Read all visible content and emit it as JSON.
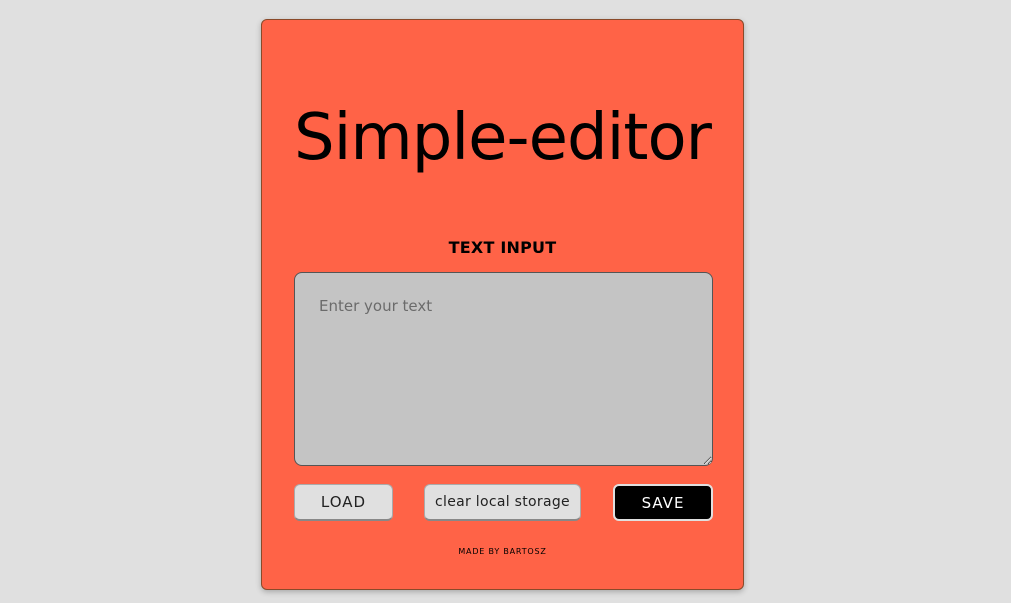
{
  "app": {
    "title": "Simple-editor"
  },
  "editor": {
    "label": "TEXT INPUT",
    "placeholder": "Enter your text",
    "value": ""
  },
  "actions": {
    "load_label": "LOAD",
    "clear_label": "clear local storage",
    "save_label": "SAVE"
  },
  "footer": {
    "credit": "MADE BY BARTOSZ"
  },
  "colors": {
    "page_background": "#e0e0e0",
    "card_background": "#ff6347",
    "textarea_background": "#c4c4c4",
    "save_button_background": "#000000"
  }
}
